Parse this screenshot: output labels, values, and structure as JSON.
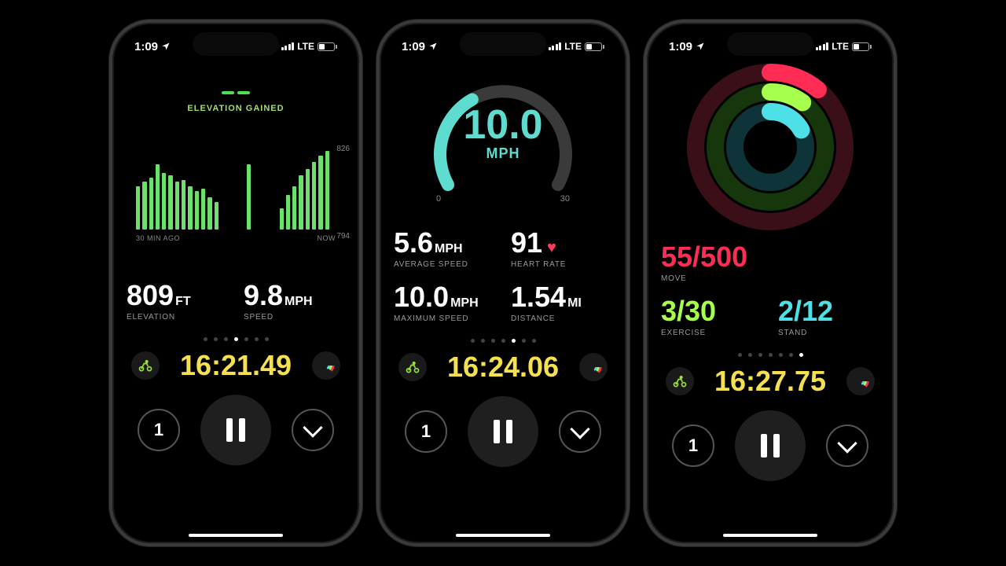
{
  "status": {
    "time": "1:09",
    "carrier": "LTE",
    "battery": "28"
  },
  "screens": [
    {
      "title": "ELEVATION GAINED",
      "chart_data": {
        "type": "bar",
        "x_start_label": "30 MIN AGO",
        "x_end_label": "NOW",
        "y_top": "826",
        "y_bot": "794",
        "ylim": [
          794,
          826
        ],
        "values": [
          810,
          812,
          814,
          820,
          816,
          815,
          812,
          813,
          810,
          808,
          809,
          805,
          803,
          0,
          0,
          0,
          0,
          820,
          0,
          0,
          0,
          0,
          800,
          806,
          810,
          815,
          818,
          821,
          824,
          826,
          0
        ]
      },
      "stats": {
        "elevation": {
          "value": "809",
          "unit": "FT",
          "label": "ELEVATION"
        },
        "speed": {
          "value": "9.8",
          "unit": "MPH",
          "label": "SPEED"
        }
      },
      "page_active": 3,
      "timer": "16:21.49"
    },
    {
      "gauge": {
        "value": "10.0",
        "unit": "MPH",
        "min": "0",
        "max": "30",
        "fill_fraction": 0.333
      },
      "stats": {
        "avg_speed": {
          "value": "5.6",
          "unit": "MPH",
          "label": "AVERAGE SPEED"
        },
        "heart": {
          "value": "91",
          "unit": "",
          "label": "HEART RATE"
        },
        "max_speed": {
          "value": "10.0",
          "unit": "MPH",
          "label": "MAXIMUM SPEED"
        },
        "distance": {
          "value": "1.54",
          "unit": "MI",
          "label": "DISTANCE"
        }
      },
      "page_active": 4,
      "timer": "16:24.06"
    },
    {
      "rings": {
        "move": {
          "fraction": 0.11,
          "color": "#ff2d55"
        },
        "exercise": {
          "fraction": 0.1,
          "color": "#a6ff4d"
        },
        "stand": {
          "fraction": 0.17,
          "color": "#4de0e6"
        }
      },
      "stats": {
        "move": {
          "value": "55/500",
          "label": "MOVE"
        },
        "exercise": {
          "value": "3/30",
          "label": "EXERCISE"
        },
        "stand": {
          "value": "2/12",
          "label": "STAND"
        }
      },
      "page_active": 6,
      "timer": "16:27.75"
    }
  ],
  "page_count": 7,
  "controls": {
    "lock": "1"
  },
  "colors": {
    "accent_green": "#6be06b",
    "accent_teal": "#5fdcd0",
    "accent_yellow": "#f5e050",
    "move": "#ff2d55",
    "exercise": "#a6ff4d",
    "stand": "#4de0e6"
  }
}
